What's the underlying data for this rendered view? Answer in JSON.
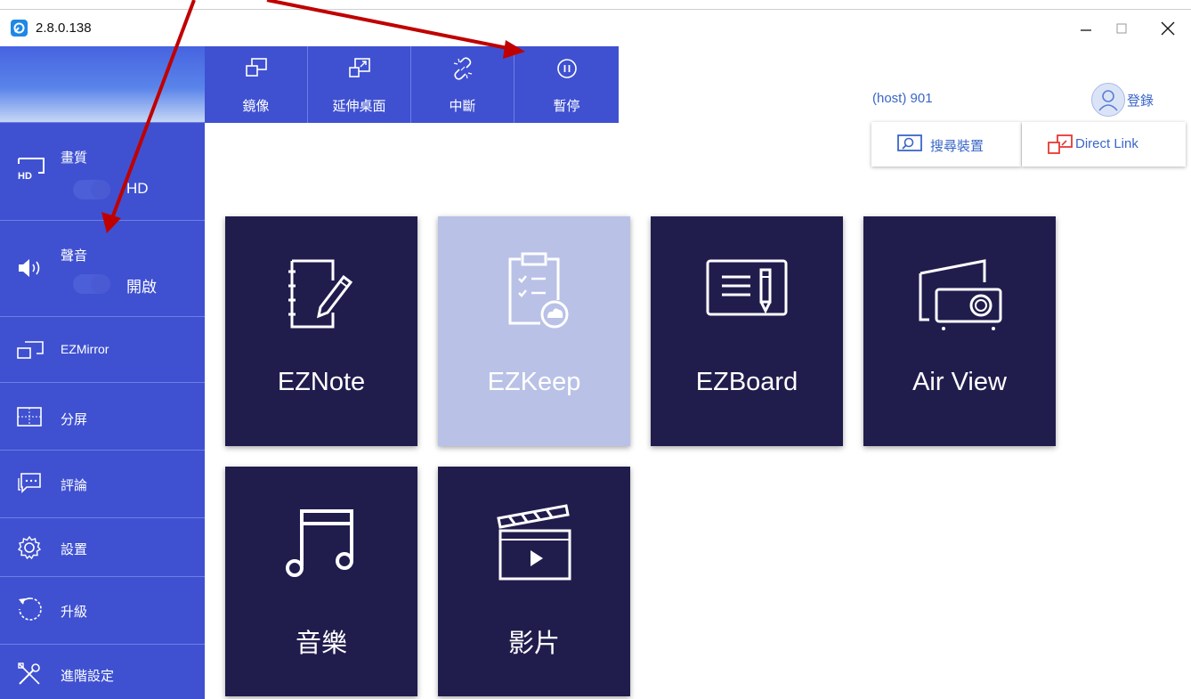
{
  "window": {
    "version": "2.8.0.138",
    "minimize_icon": "minimize-icon",
    "maximize_icon": "maximize-icon",
    "close_icon": "close-icon"
  },
  "toolbar": {
    "items": [
      {
        "label": "鏡像",
        "icon": "mirror-icon"
      },
      {
        "label": "延伸桌面",
        "icon": "extend-desktop-icon"
      },
      {
        "label": "中斷",
        "icon": "disconnect-icon"
      },
      {
        "label": "暫停",
        "icon": "pause-icon"
      }
    ]
  },
  "sidebar": {
    "quality": {
      "label": "畫質",
      "value": "HD",
      "icon": "hd-display-icon"
    },
    "sound": {
      "label": "聲音",
      "value": "開啟",
      "icon": "speaker-icon"
    },
    "items": [
      {
        "label": "EZMirror",
        "icon": "ezmirror-icon"
      },
      {
        "label": "分屏",
        "icon": "split-screen-icon"
      },
      {
        "label": "評論",
        "icon": "comment-icon"
      },
      {
        "label": "設置",
        "icon": "gear-icon"
      },
      {
        "label": "升級",
        "icon": "upgrade-icon"
      },
      {
        "label": "進階設定",
        "icon": "tools-icon"
      }
    ]
  },
  "header": {
    "host": "(host) 901",
    "login_label": "登錄",
    "search_devices_label": "搜尋裝置",
    "direct_link_label": "Direct Link"
  },
  "tiles": [
    {
      "label": "EZNote",
      "icon": "notebook-pen-icon"
    },
    {
      "label": "EZKeep",
      "icon": "clipboard-cloud-icon"
    },
    {
      "label": "EZBoard",
      "icon": "whiteboard-icon"
    },
    {
      "label": "Air View",
      "icon": "projector-icon"
    },
    {
      "label": "音樂",
      "icon": "music-note-icon"
    },
    {
      "label": "影片",
      "icon": "clapperboard-icon"
    }
  ],
  "colors": {
    "sidebar": "#3f51d1",
    "tile": "#201d4d",
    "tile_selected": "#b9c1e6",
    "link": "#3a66c8",
    "annotation": "#c00000"
  }
}
